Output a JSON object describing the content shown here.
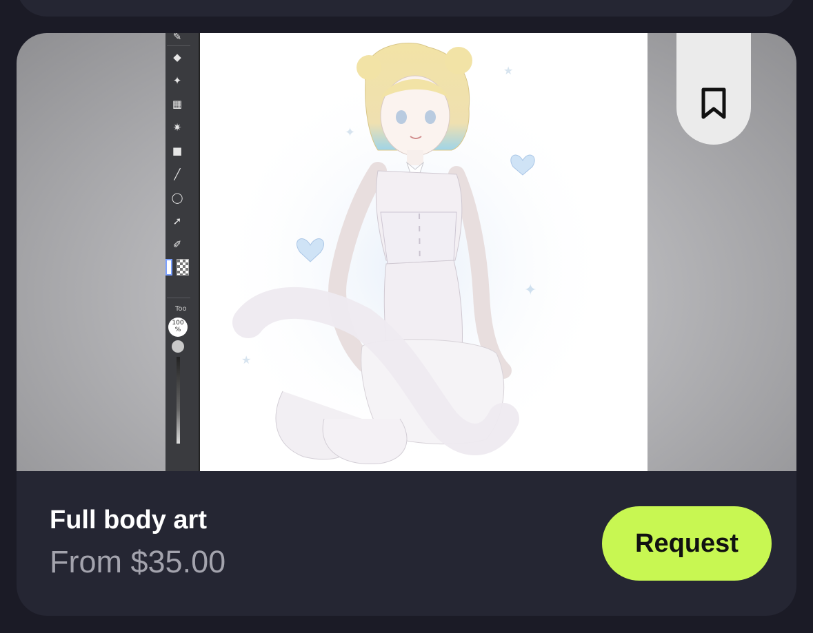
{
  "listing": {
    "title": "Full body art",
    "price": "From $35.00",
    "request_label": "Request",
    "bookmark_icon": "bookmark-icon"
  },
  "artwork": {
    "description": "",
    "app_toolbar": {
      "tools": [
        "pen-icon",
        "eraser-icon",
        "sparkle-icon",
        "grid-icon",
        "magic-wand-icon",
        "gradient-icon",
        "line-icon",
        "lasso-icon",
        "select-arrow-icon",
        "eyedropper-icon"
      ],
      "tab_label": "Too",
      "opacity_value": "100",
      "opacity_unit": "%"
    }
  },
  "colors": {
    "background": "#1b1b26",
    "card": "#252633",
    "accent": "#c8f752",
    "price_text": "#a3a3ad"
  }
}
